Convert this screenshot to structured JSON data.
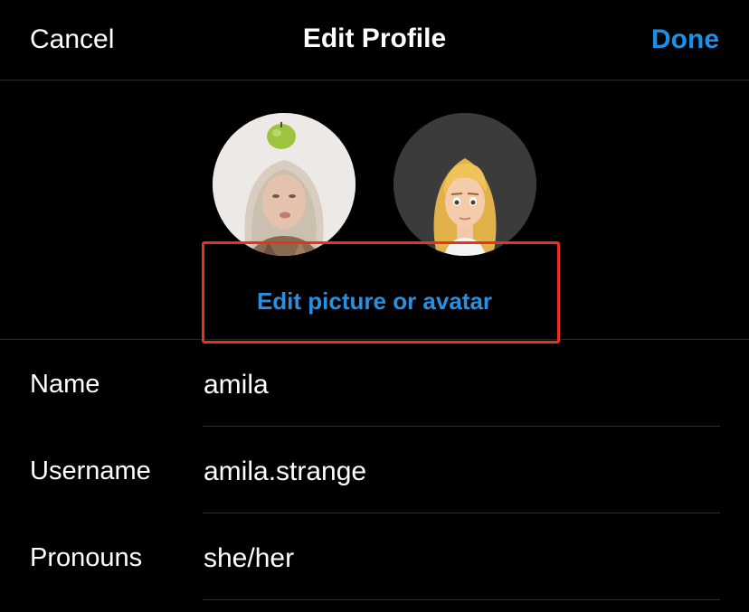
{
  "header": {
    "cancel_label": "Cancel",
    "title": "Edit Profile",
    "done_label": "Done"
  },
  "avatars": {
    "edit_label": "Edit picture or avatar"
  },
  "fields": [
    {
      "label": "Name",
      "value": "amila"
    },
    {
      "label": "Username",
      "value": "amila.strange"
    },
    {
      "label": "Pronouns",
      "value": "she/her"
    }
  ],
  "colors": {
    "background": "#000000",
    "accent": "#1d8fe6",
    "highlight": "#e8321f",
    "divider": "#262626"
  }
}
